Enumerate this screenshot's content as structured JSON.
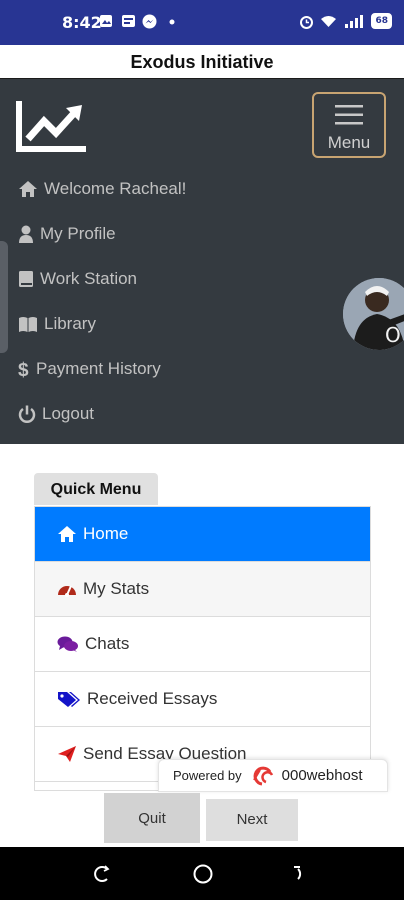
{
  "status_bar": {
    "time": "8:42",
    "battery": "68",
    "background": "#283593"
  },
  "app": {
    "title": "Exodus Initiative"
  },
  "navbar": {
    "background": "#343a40",
    "menu_label": "Menu",
    "items": [
      {
        "icon": "home-icon",
        "label": "Welcome Racheal!"
      },
      {
        "icon": "user-icon",
        "label": "My Profile"
      },
      {
        "icon": "book-icon",
        "label": "Work Station"
      },
      {
        "icon": "open-book-icon",
        "label": "Library"
      },
      {
        "icon": "dollar-icon",
        "label": "Payment History"
      },
      {
        "icon": "power-icon",
        "label": "Logout"
      }
    ]
  },
  "quick_menu": {
    "title": "Quick Menu",
    "active_color": "#007bff",
    "items": [
      {
        "icon": "home-icon",
        "label": "Home"
      },
      {
        "icon": "gauge-icon",
        "label": "My Stats"
      },
      {
        "icon": "comments-icon",
        "label": "Chats"
      },
      {
        "icon": "tags-icon",
        "label": "Received Essays"
      },
      {
        "icon": "paper-plane-icon",
        "label": "Send Essay Question"
      }
    ]
  },
  "footer": {
    "powered_by": "Powered by",
    "host": "000webhost",
    "quit_label": "Quit",
    "next_label": "Next"
  }
}
